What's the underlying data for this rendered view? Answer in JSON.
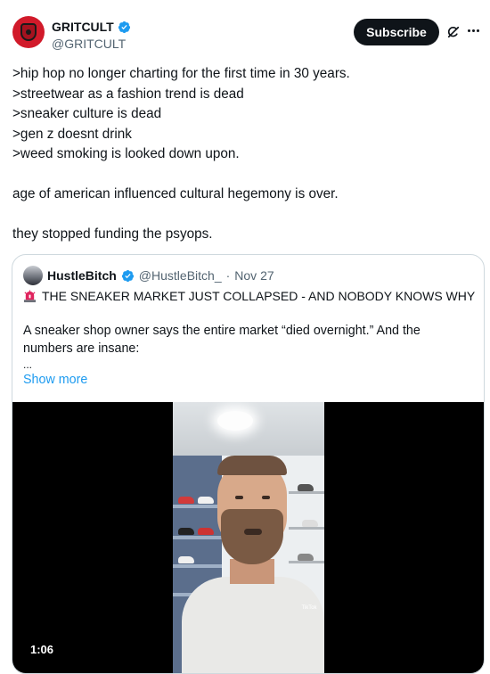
{
  "author": {
    "display_name": "GRITCULT",
    "handle": "@GRITCULT",
    "verified": true,
    "avatar_color": "#d11a2a"
  },
  "actions": {
    "subscribe_label": "Subscribe",
    "grok_icon": "grok-icon",
    "more_icon": "more-icon"
  },
  "tweet": {
    "lines": [
      ">hip hop no longer charting for the first time in 30 years.",
      ">streetwear as a fashion trend is dead",
      ">sneaker culture is dead",
      ">gen z doesnt drink",
      ">weed smoking is looked down upon.",
      "age of american influenced cultural hegemony is over.",
      "they stopped funding the psyops."
    ]
  },
  "quote": {
    "display_name": "HustleBitch",
    "handle": "@HustleBitch_",
    "separator": "·",
    "date": "Nov 27",
    "verified": true,
    "title_icon": "siren-icon",
    "title": "THE SNEAKER MARKET JUST COLLAPSED - AND NOBODY KNOWS WHY",
    "body_line1": "A sneaker shop owner says the entire market “died overnight.” And the",
    "body_line2": "numbers are insane:",
    "ellipsis": "...",
    "show_more": "Show more",
    "video": {
      "duration": "1:06",
      "watermark": "TikTok"
    }
  },
  "colors": {
    "text": "#0f1419",
    "secondary": "#536471",
    "link": "#1d9bf0",
    "verified_blue": "#1d9bf0",
    "border": "#cfd9de"
  }
}
